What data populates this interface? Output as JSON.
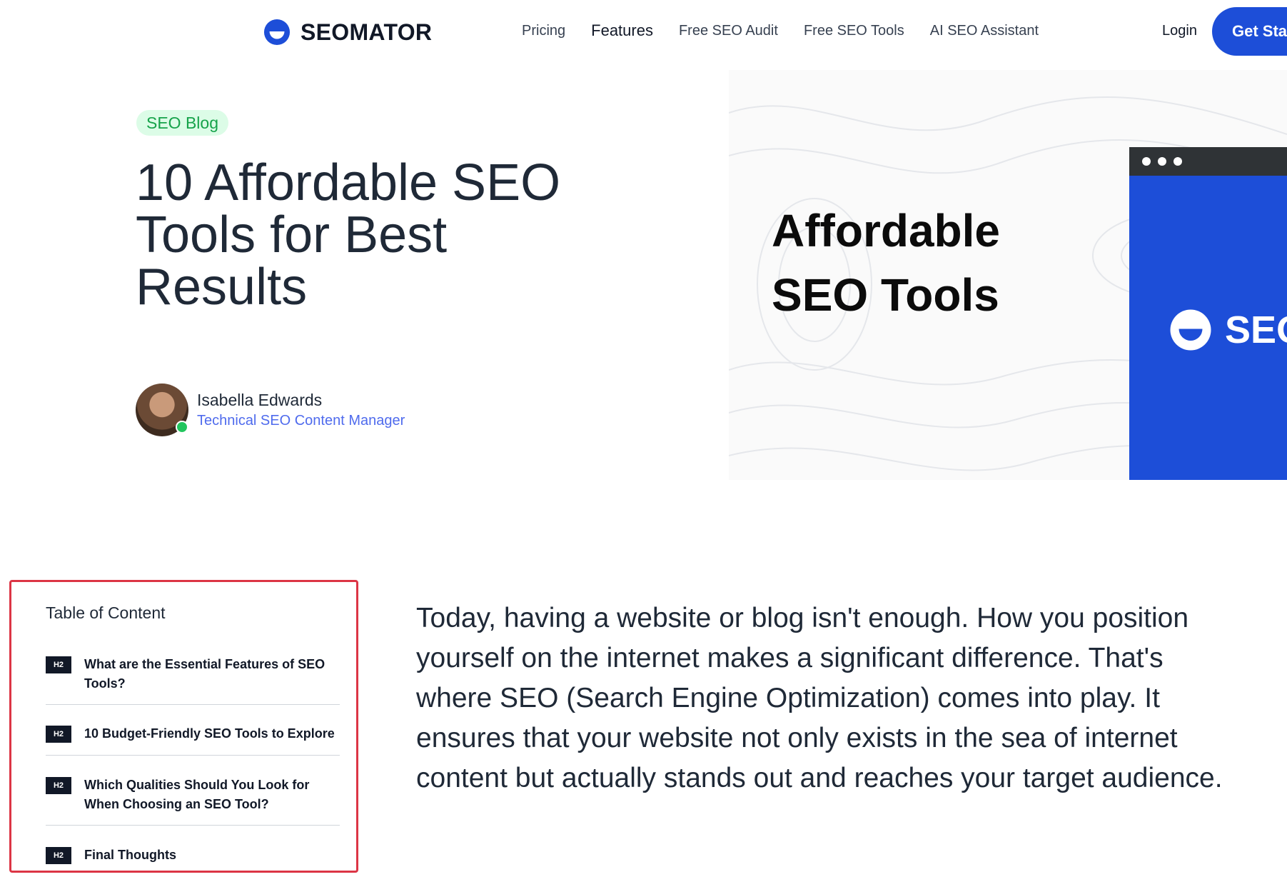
{
  "header": {
    "brand": "SEOMATOR",
    "nav": [
      "Pricing",
      "Features",
      "Free SEO Audit",
      "Free SEO Tools",
      "AI SEO Assistant"
    ],
    "login": "Login",
    "cta": "Get Started"
  },
  "hero": {
    "tag": "SEO Blog",
    "title": "10 Affordable SEO Tools for Best Results",
    "author_name": "Isabella Edwards",
    "author_role": "Technical SEO Content Manager",
    "image_line1": "Affordable",
    "image_line2": "SEO Tools",
    "image_brand": "SEO"
  },
  "toc": {
    "title": "Table of Content",
    "items": [
      {
        "badge": "H2",
        "text": "What are the Essential Features of SEO Tools?"
      },
      {
        "badge": "H2",
        "text": "10 Budget-Friendly SEO Tools to Explore"
      },
      {
        "badge": "H2",
        "text": "Which Qualities Should You Look for When Choosing an SEO Tool?"
      },
      {
        "badge": "H2",
        "text": "Final Thoughts"
      }
    ]
  },
  "intro": "Today, having a website or blog isn't enough. How you position yourself on the internet makes a significant difference. That's where SEO (Search Engine Optimization) comes into play. It ensures that your website not only exists in the sea of internet content but actually stands out and reaches your target audience.",
  "colors": {
    "brand_blue": "#1d4ed8",
    "tag_bg": "#dcfce7",
    "tag_text": "#16a34a",
    "toc_border": "#dc3545"
  }
}
